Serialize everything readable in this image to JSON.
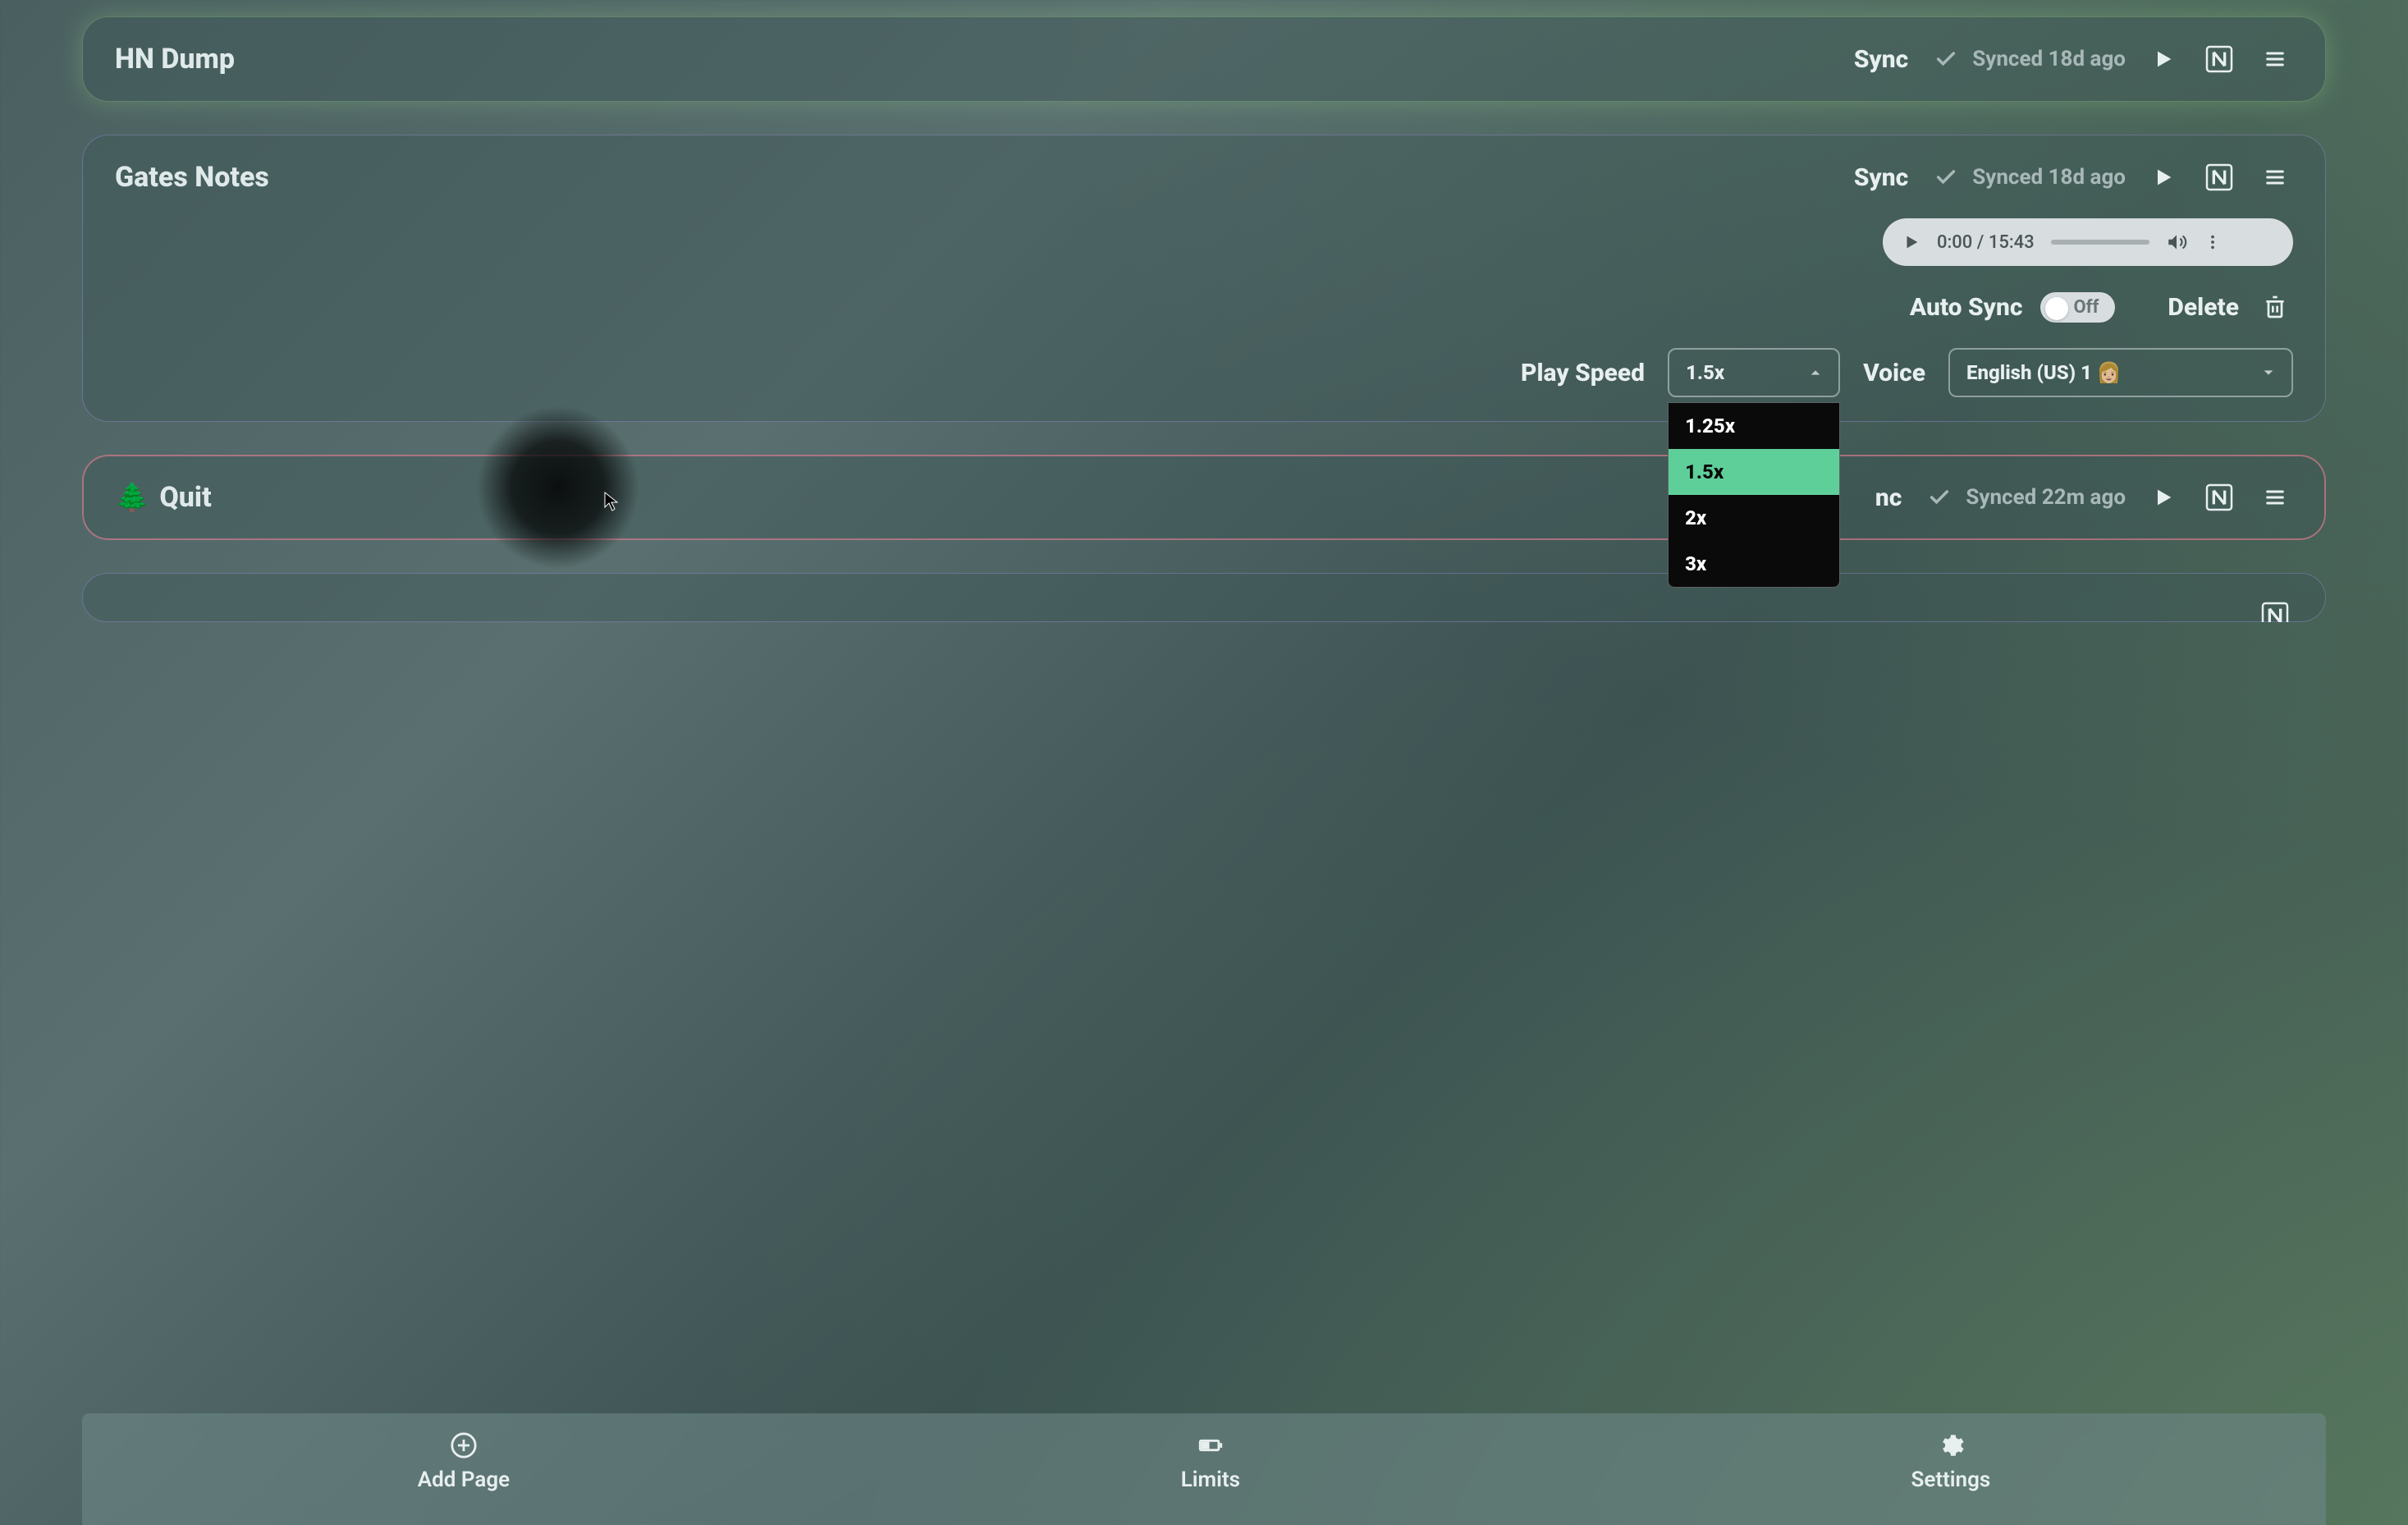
{
  "cards": [
    {
      "title": "HN Dump",
      "sync_label": "Sync",
      "synced_text": "Synced 18d ago"
    },
    {
      "title": "Gates Notes",
      "sync_label": "Sync",
      "synced_text": "Synced 18d ago",
      "audio": {
        "time": "0:00 / 15:43"
      },
      "auto_sync_label": "Auto Sync",
      "auto_sync_value": "Off",
      "delete_label": "Delete",
      "play_speed_label": "Play Speed",
      "play_speed_value": "1.5x",
      "play_speed_options": [
        "1.25x",
        "1.5x",
        "2x",
        "3x"
      ],
      "voice_label": "Voice",
      "voice_value": "English (US) 1 👩🏼"
    },
    {
      "title_emoji": "🌲",
      "title": "Quit",
      "sync_label": "nc",
      "synced_text": "Synced 22m ago"
    }
  ],
  "bottom": [
    {
      "label": "Add Page"
    },
    {
      "label": "Limits"
    },
    {
      "label": "Settings"
    }
  ]
}
